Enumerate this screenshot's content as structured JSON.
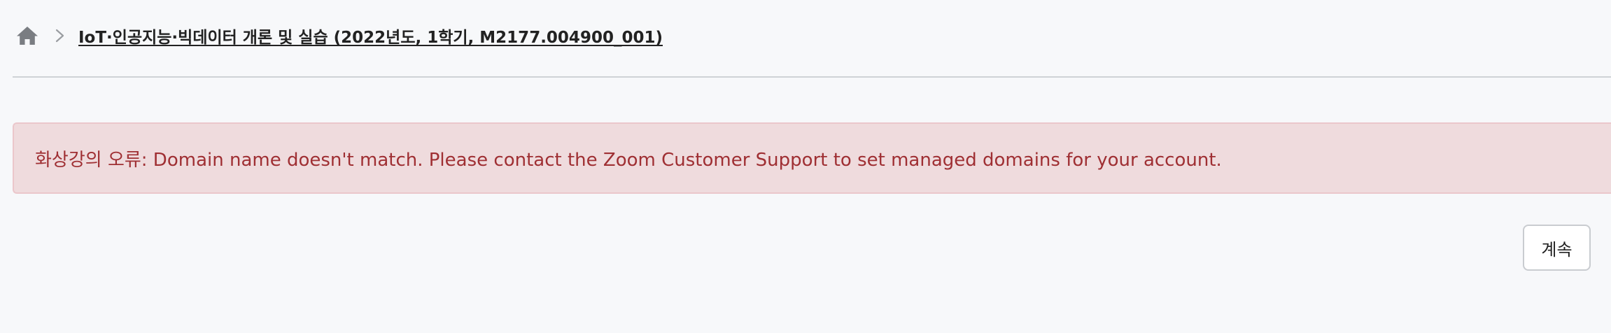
{
  "breadcrumb": {
    "home_icon": "home-icon",
    "separator_icon": "chevron-right-icon",
    "course_title": "IoT·인공지능·빅데이터 개론 및 실습 (2022년도, 1학기, M2177.004900_001)"
  },
  "alert": {
    "message": "화상강의 오류: Domain name doesn't match. Please contact the Zoom Customer Support to set managed domains for your account.",
    "background_color": "#efdbdd",
    "text_color": "#9f2f33"
  },
  "actions": {
    "continue_label": "계속"
  }
}
